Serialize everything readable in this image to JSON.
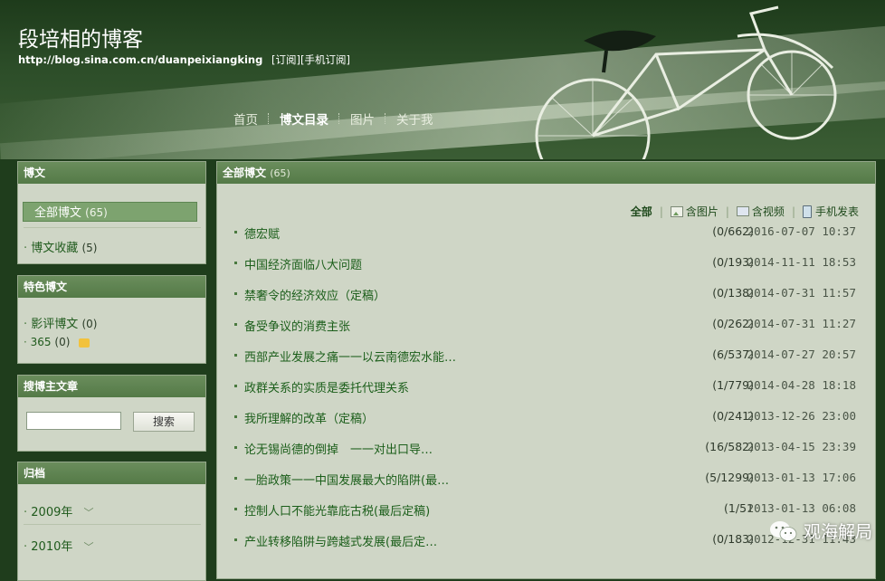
{
  "header": {
    "title": "段培相的博客",
    "url": "http://blog.sina.com.cn/duanpeixiangking",
    "subscribe": "[订阅]",
    "mobile_subscribe": "[手机订阅]"
  },
  "nav": {
    "items": [
      {
        "label": "首页"
      },
      {
        "label": "博文目录"
      },
      {
        "label": "图片"
      },
      {
        "label": "关于我"
      }
    ]
  },
  "sidebar": {
    "blog": {
      "heading": "博文",
      "items": [
        {
          "label": "全部博文",
          "count": "(65)"
        },
        {
          "label": "博文收藏",
          "count": "(5)"
        }
      ]
    },
    "featured": {
      "heading": "特色博文",
      "items": [
        {
          "label": "影评博文",
          "count": "(0)"
        },
        {
          "label": "365",
          "count": "(0)"
        }
      ]
    },
    "search": {
      "heading": "搜博主文章",
      "input_value": "",
      "button": "搜索"
    },
    "archive": {
      "heading": "归档",
      "items": [
        {
          "label": "2009年"
        },
        {
          "label": "2010年"
        }
      ]
    }
  },
  "main": {
    "heading": "全部博文",
    "count": "(65)",
    "filters": {
      "all": "全部",
      "images": "含图片",
      "video": "含视频",
      "mobile": "手机发表"
    },
    "articles": [
      {
        "title": "德宏赋",
        "stats": "(0/662)",
        "date": "2016-07-07 10:37"
      },
      {
        "title": "中国经济面临八大问题",
        "stats": "(0/193)",
        "date": "2014-11-11 18:53"
      },
      {
        "title": "禁奢令的经济效应（定稿）",
        "stats": "(0/138)",
        "date": "2014-07-31 11:57"
      },
      {
        "title": "备受争议的消费主张",
        "stats": "(0/262)",
        "date": "2014-07-31 11:27"
      },
      {
        "title": "西部产业发展之痛一一以云南德宏水能…",
        "stats": "(6/537)",
        "date": "2014-07-27 20:57"
      },
      {
        "title": "政群关系的实质是委托代理关系",
        "stats": "(1/779)",
        "date": "2014-04-28 18:18"
      },
      {
        "title": "我所理解的改革（定稿）",
        "stats": "(0/241)",
        "date": "2013-12-26 23:00"
      },
      {
        "title": "论无锡尚德的倒掉　一一对出口导…",
        "stats": "(16/582)",
        "date": "2013-04-15 23:39"
      },
      {
        "title": "一胎政策一一中国发展最大的陷阱(最…",
        "stats": "(5/1299)",
        "date": "2013-01-13 17:06"
      },
      {
        "title": "控制人口不能光靠庇古税(最后定稿)",
        "stats": "(1/51",
        "date": "2013-01-13 06:08"
      },
      {
        "title": "产业转移陷阱与跨越式发展(最后定…",
        "stats": "(0/183)",
        "date": "2012-12-31 11:43"
      }
    ]
  },
  "watermark": {
    "text": "观海解局"
  }
}
